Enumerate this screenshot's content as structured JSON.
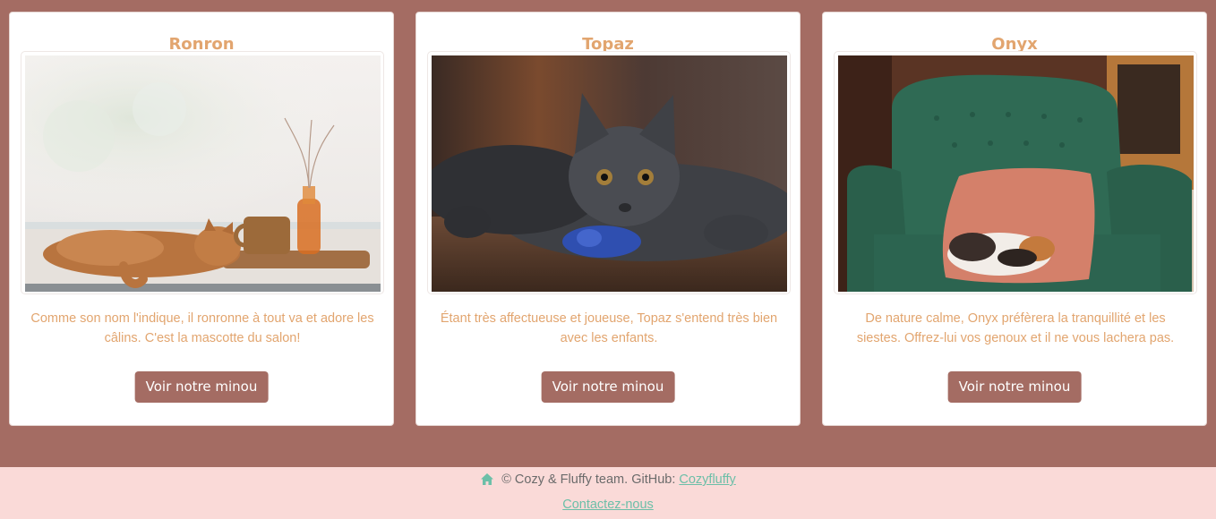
{
  "colors": {
    "page_background": "#a46c63",
    "card_background": "#ffffff",
    "accent_text": "#e2a56f",
    "button_background": "#a46c63",
    "button_text": "#ffffff",
    "footer_background": "#fadad8",
    "footer_link": "#6cbfa8",
    "footer_text": "#6b6b6b"
  },
  "cards": [
    {
      "name": "Ronron",
      "description": "Comme son nom l'indique, il ronronne à tout va et adore les câlins. C'est la mascotte du salon!",
      "button_label": "Voir notre minou",
      "photo_alt": "Chat roux allongé près d'une fenêtre"
    },
    {
      "name": "Topaz",
      "description": "Étant très affectueuse et joueuse, Topaz s'entend très bien avec les enfants.",
      "button_label": "Voir notre minou",
      "photo_alt": "Chat gris jouant avec une souris bleue"
    },
    {
      "name": "Onyx",
      "description": "De nature calme, Onyx préfèrera la tranquillité et les siestes. Offrez-lui vos genoux et il ne vous lachera pas.",
      "button_label": "Voir notre minou",
      "photo_alt": "Chat tricolore endormi dans un fauteuil vert"
    }
  ],
  "footer": {
    "icon": "home-icon",
    "credit_text": "© Cozy & Fluffy team. GitHub: ",
    "github_link_text": "Cozyfluffy",
    "contact_link_text": "Contactez-nous"
  }
}
